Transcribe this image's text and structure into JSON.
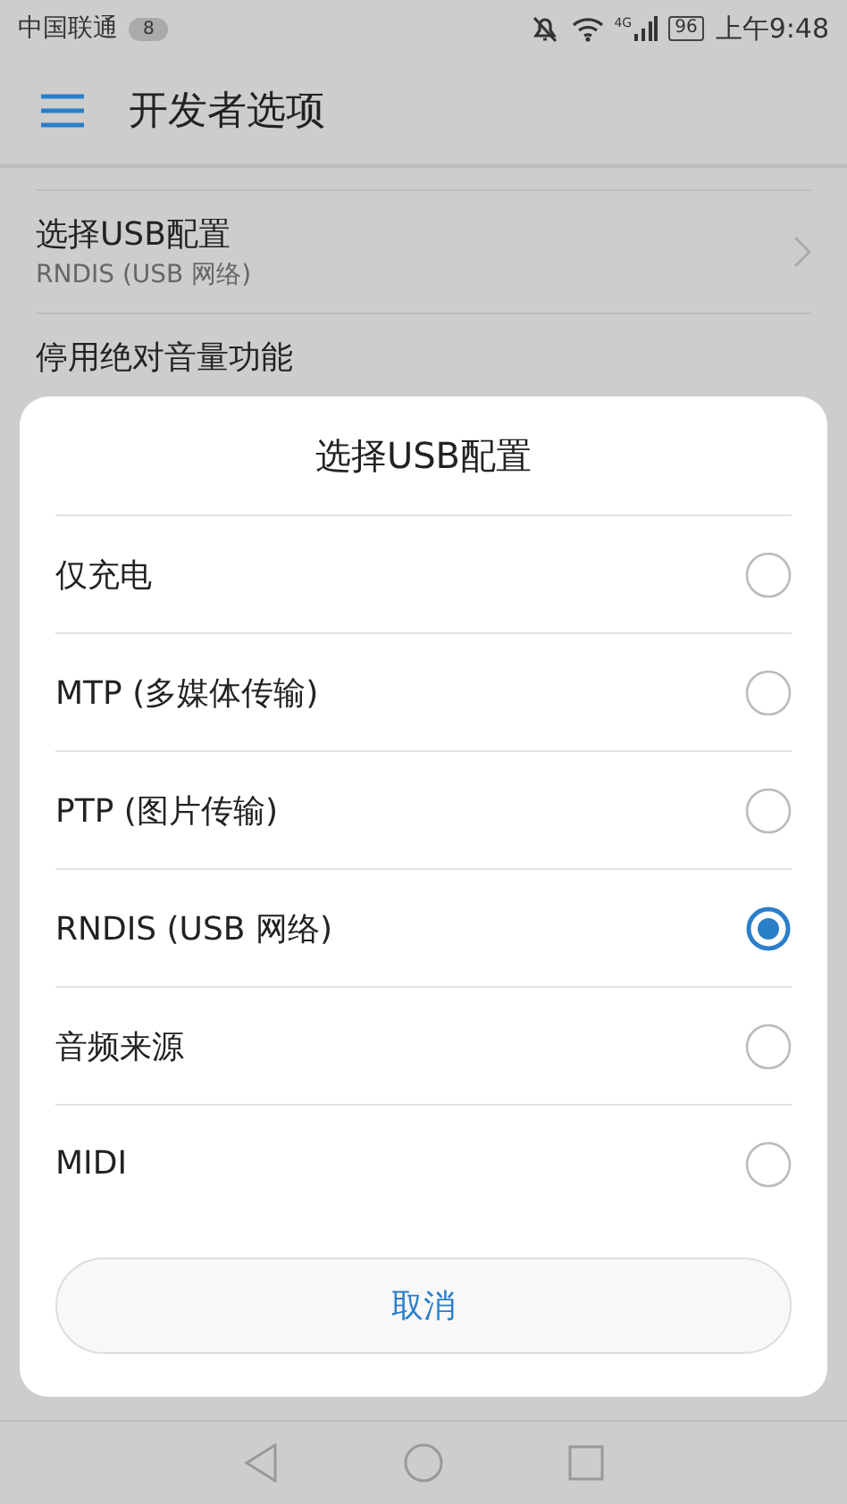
{
  "status_bar": {
    "carrier": "中国联通",
    "notification_count": "8",
    "network": "4G",
    "battery": "96",
    "time": "上午9:48"
  },
  "app_bar": {
    "title": "开发者选项"
  },
  "settings": [
    {
      "title": "选择USB配置",
      "summary": "RNDIS (USB 网络)",
      "has_arrow": true
    },
    {
      "title": "停用绝对音量功能",
      "has_arrow": false
    }
  ],
  "dialog": {
    "title": "选择USB配置",
    "options": [
      {
        "label": "仅充电",
        "selected": false
      },
      {
        "label": "MTP (多媒体传输)",
        "selected": false
      },
      {
        "label": "PTP (图片传输)",
        "selected": false
      },
      {
        "label": "RNDIS (USB 网络)",
        "selected": true
      },
      {
        "label": "音频来源",
        "selected": false
      },
      {
        "label": "MIDI",
        "selected": false
      }
    ],
    "cancel": "取消"
  }
}
